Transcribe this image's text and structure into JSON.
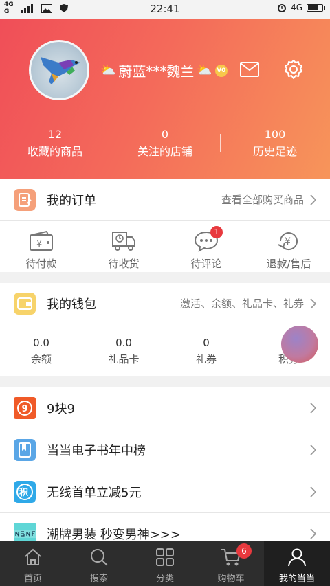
{
  "status_bar": {
    "network_top": "4G",
    "network_bottom": "G",
    "time": "22:41",
    "net_type": "4G",
    "battery_level": 0.75
  },
  "profile": {
    "username": "蔚蓝***魏兰",
    "vip_label": "V0",
    "stats": [
      {
        "value": "12",
        "label": "收藏的商品"
      },
      {
        "value": "0",
        "label": "关注的店铺"
      },
      {
        "value": "100",
        "label": "历史足迹"
      }
    ]
  },
  "orders": {
    "title": "我的订单",
    "link": "查看全部购买商品",
    "items": [
      {
        "label": "待付款",
        "icon": "wallet-yen-icon"
      },
      {
        "label": "待收货",
        "icon": "delivery-truck-icon"
      },
      {
        "label": "待评论",
        "icon": "chat-bubble-icon",
        "badge": "1"
      },
      {
        "label": "退款/售后",
        "icon": "refund-yen-icon"
      }
    ]
  },
  "wallet": {
    "title": "我的钱包",
    "link": "激活、余额、礼品卡、礼券",
    "items": [
      {
        "value": "0.0",
        "label": "余额"
      },
      {
        "value": "0.0",
        "label": "礼品卡"
      },
      {
        "value": "0",
        "label": "礼券"
      },
      {
        "value": "",
        "label": "积分"
      }
    ]
  },
  "promos": [
    {
      "title": "9块9",
      "icon": "nine-icon",
      "color": "#f05a28"
    },
    {
      "title": "当当电子书年中榜",
      "icon": "ebook-icon",
      "color": "#5aa6e6"
    },
    {
      "title": "无线首单立减5元",
      "icon": "points-icon",
      "color": "#2fa9e8"
    },
    {
      "title": "潮牌男装 秒变男神>>>",
      "icon": "nsnf-brand-icon",
      "color": "#5fd6d6"
    }
  ],
  "tabs": [
    {
      "label": "首页",
      "icon": "home-icon"
    },
    {
      "label": "搜索",
      "icon": "search-icon"
    },
    {
      "label": "分类",
      "icon": "category-grid-icon"
    },
    {
      "label": "购物车",
      "icon": "cart-icon",
      "badge": "6"
    },
    {
      "label": "我的当当",
      "icon": "user-icon",
      "active": true
    }
  ],
  "colors": {
    "header_start": "#f04e58",
    "header_end": "#f7955a",
    "badge": "#e8393e",
    "tabbar": "#2d2d2d"
  }
}
